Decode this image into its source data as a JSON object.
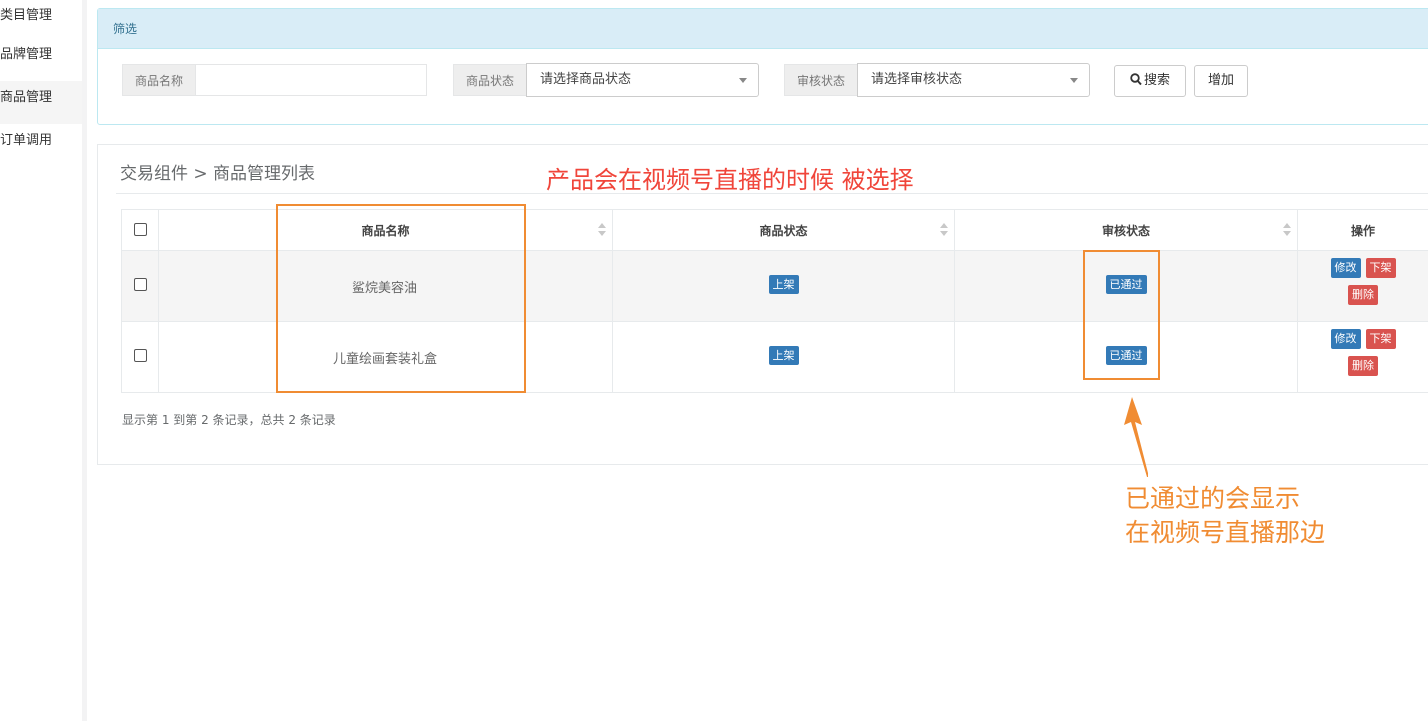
{
  "sidebar": {
    "items": [
      {
        "label": "类目管理",
        "active": false
      },
      {
        "label": "品牌管理",
        "active": false
      },
      {
        "label": "商品管理",
        "active": true
      },
      {
        "label": "订单调用",
        "active": false
      }
    ]
  },
  "filter": {
    "title": "筛选",
    "name_label": "商品名称",
    "name_value": "",
    "status_label": "商品状态",
    "status_placeholder": "请选择商品状态",
    "audit_label": "审核状态",
    "audit_placeholder": "请选择审核状态",
    "search_button": "搜索",
    "add_button": "增加"
  },
  "list": {
    "breadcrumb": "交易组件 > 商品管理列表",
    "columns": [
      "商品名称",
      "商品状态",
      "审核状态",
      "操作"
    ],
    "rows": [
      {
        "name": "鲨烷美容油",
        "status": "上架",
        "audit": "已通过",
        "edit": "修改",
        "offshelf": "下架",
        "delete": "删除"
      },
      {
        "name": "儿童绘画套装礼盒",
        "status": "上架",
        "audit": "已通过",
        "edit": "修改",
        "offshelf": "下架",
        "delete": "删除"
      }
    ],
    "pager_text": "显示第 1 到第 2 条记录，总共 2 条记录"
  },
  "annotations": {
    "top_note": "产品会在视频号直播的时候 被选择",
    "side_note_line1": "已通过的会显示",
    "side_note_line2": "在视频号直播那边"
  },
  "colors": {
    "primary": "#337ab7",
    "danger": "#d9534f",
    "annotation_orange": "#f08c33",
    "annotation_red": "#f0453a",
    "filter_header_bg": "#d9edf7"
  }
}
